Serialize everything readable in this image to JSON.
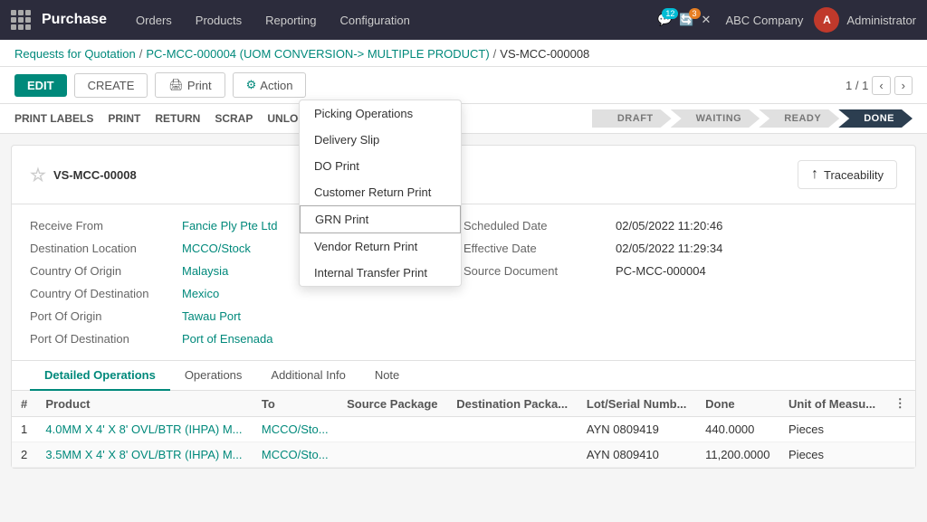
{
  "navbar": {
    "brand": "Purchase",
    "menu": [
      "Orders",
      "Products",
      "Reporting",
      "Configuration"
    ],
    "chat_badge": "12",
    "clock_badge": "3",
    "company": "ABC Company",
    "admin_initial": "A",
    "admin_name": "Administrator"
  },
  "breadcrumb": {
    "root": "Requests for Quotation",
    "parent": "PC-MCC-000004 (UOM CONVERSION-> MULTIPLE PRODUCT)",
    "current": "VS-MCC-000008"
  },
  "toolbar": {
    "edit_label": "EDIT",
    "create_label": "CREATE",
    "print_label": "Print",
    "action_label": "Action",
    "pagination": "1 / 1"
  },
  "dropdown": {
    "items": [
      {
        "label": "Picking Operations",
        "highlighted": false
      },
      {
        "label": "Delivery Slip",
        "highlighted": false
      },
      {
        "label": "DO Print",
        "highlighted": false
      },
      {
        "label": "Customer Return Print",
        "highlighted": false
      },
      {
        "label": "GRN Print",
        "highlighted": true
      },
      {
        "label": "Vendor Return Print",
        "highlighted": false
      },
      {
        "label": "Internal Transfer Print",
        "highlighted": false
      }
    ]
  },
  "sub_toolbar": {
    "items": [
      "PRINT LABELS",
      "PRINT",
      "RETURN",
      "SCRAP",
      "UNLOCK"
    ]
  },
  "status": {
    "steps": [
      "DRAFT",
      "WAITING",
      "READY",
      "DONE"
    ],
    "active": "DONE"
  },
  "document": {
    "title": "VS-MCC-00008",
    "traceability_label": "Traceability"
  },
  "fields_left": [
    {
      "label": "Receive From",
      "value": "Fancie Ply Pte Ltd",
      "is_link": true
    },
    {
      "label": "Destination Location",
      "value": "MCCO/Stock",
      "is_link": true
    },
    {
      "label": "Country Of Origin",
      "value": "Malaysia",
      "is_link": true
    },
    {
      "label": "Country Of Destination",
      "value": "Mexico",
      "is_link": true
    },
    {
      "label": "Port Of Origin",
      "value": "Tawau Port",
      "is_link": true
    },
    {
      "label": "Port Of Destination",
      "value": "Port of Ensenada",
      "is_link": true
    }
  ],
  "fields_right": [
    {
      "label": "Scheduled Date",
      "value": "02/05/2022 11:20:46",
      "is_link": false
    },
    {
      "label": "Effective Date",
      "value": "02/05/2022 11:29:34",
      "is_link": false
    },
    {
      "label": "Source Document",
      "value": "PC-MCC-000004",
      "is_link": false
    }
  ],
  "tabs": [
    {
      "label": "Detailed Operations",
      "active": true
    },
    {
      "label": "Operations",
      "active": false
    },
    {
      "label": "Additional Info",
      "active": false
    },
    {
      "label": "Note",
      "active": false
    }
  ],
  "table": {
    "columns": [
      "#",
      "Product",
      "To",
      "Source Package",
      "Destination Packa...",
      "Lot/Serial Numb...",
      "Done",
      "Unit of Measu..."
    ],
    "rows": [
      {
        "num": "1",
        "product": "4.0MM X 4' X 8' OVL/BTR (IHPA) M...",
        "to": "MCCO/Sto...",
        "source_pkg": "",
        "dest_pkg": "",
        "lot": "AYN 0809419",
        "done": "440.0000",
        "uom": "Pieces"
      },
      {
        "num": "2",
        "product": "3.5MM X 4' X 8' OVL/BTR (IHPA) M...",
        "to": "MCCO/Sto...",
        "source_pkg": "",
        "dest_pkg": "",
        "lot": "AYN 0809410",
        "done": "11,200.0000",
        "uom": "Pieces"
      }
    ]
  }
}
